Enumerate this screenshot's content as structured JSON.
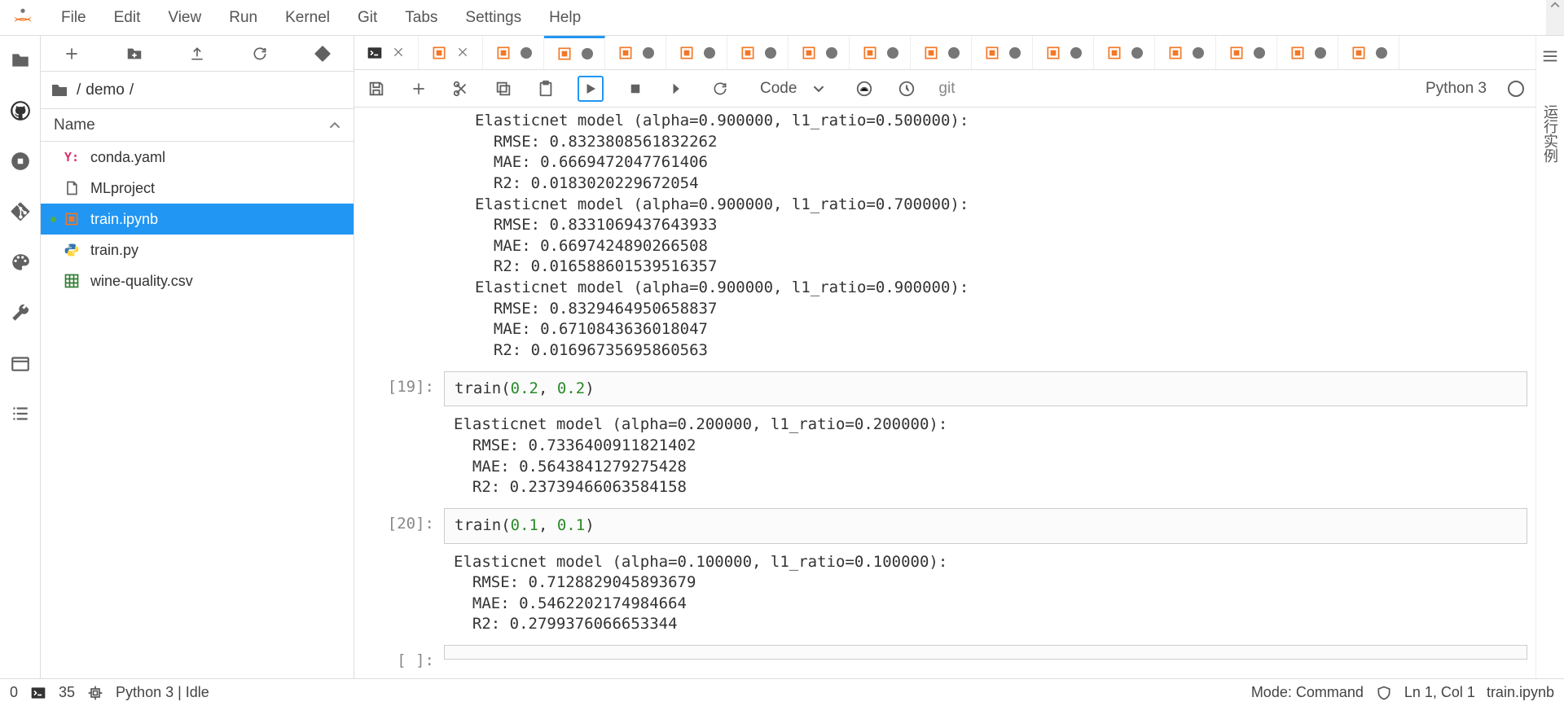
{
  "menubar": [
    "File",
    "Edit",
    "View",
    "Run",
    "Kernel",
    "Git",
    "Tabs",
    "Settings",
    "Help"
  ],
  "filebrowser": {
    "breadcrumbs": [
      "/",
      "demo",
      "/"
    ],
    "name_header": "Name",
    "files": [
      {
        "name": "conda.yaml",
        "icon": "yaml",
        "selected": false
      },
      {
        "name": "MLproject",
        "icon": "file",
        "selected": false
      },
      {
        "name": "train.ipynb",
        "icon": "nb",
        "selected": true,
        "running": true
      },
      {
        "name": "train.py",
        "icon": "py",
        "selected": false
      },
      {
        "name": "wine-quality.csv",
        "icon": "csv",
        "selected": false
      }
    ]
  },
  "tabs": [
    {
      "icon": "terminal",
      "dotType": "close"
    },
    {
      "icon": "nb",
      "dotType": "close"
    },
    {
      "icon": "nb",
      "dotType": "dot"
    },
    {
      "icon": "nb",
      "dotType": "dot",
      "active": true
    },
    {
      "icon": "nb",
      "dotType": "dot"
    },
    {
      "icon": "nb",
      "dotType": "dot"
    },
    {
      "icon": "nb",
      "dotType": "dot"
    },
    {
      "icon": "nb",
      "dotType": "dot"
    },
    {
      "icon": "nb",
      "dotType": "dot"
    },
    {
      "icon": "nb",
      "dotType": "dot"
    },
    {
      "icon": "nb",
      "dotType": "dot"
    },
    {
      "icon": "nb",
      "dotType": "dot"
    },
    {
      "icon": "nb",
      "dotType": "dot"
    },
    {
      "icon": "nb",
      "dotType": "dot"
    },
    {
      "icon": "nb",
      "dotType": "dot"
    },
    {
      "icon": "nb",
      "dotType": "dot"
    },
    {
      "icon": "nb",
      "dotType": "dot"
    }
  ],
  "nb_toolbar": {
    "cell_type": "Code",
    "git_label": "git",
    "kernel_name": "Python 3"
  },
  "initial_output": "Elasticnet model (alpha=0.900000, l1_ratio=0.500000):\n  RMSE: 0.8323808561832262\n  MAE: 0.6669472047761406\n  R2: 0.0183020229672054\nElasticnet model (alpha=0.900000, l1_ratio=0.700000):\n  RMSE: 0.8331069437643933\n  MAE: 0.6697424890266508\n  R2: 0.016588601539516357\nElasticnet model (alpha=0.900000, l1_ratio=0.900000):\n  RMSE: 0.8329464950658837\n  MAE: 0.6710843636018047\n  R2: 0.01696735695860563",
  "cells": [
    {
      "prompt": "[19]:",
      "code_html": "train(<span class='num'>0.2</span>, <span class='num'>0.2</span>)",
      "output": "Elasticnet model (alpha=0.200000, l1_ratio=0.200000):\n  RMSE: 0.7336400911821402\n  MAE: 0.5643841279275428\n  R2: 0.23739466063584158"
    },
    {
      "prompt": "[20]:",
      "code_html": "train(<span class='num'>0.1</span>, <span class='num'>0.1</span>)",
      "output": "Elasticnet model (alpha=0.100000, l1_ratio=0.100000):\n  RMSE: 0.7128829045893679\n  MAE: 0.5462202174984664\n  R2: 0.2799376066653344"
    },
    {
      "prompt": "[ ]:",
      "code_html": "",
      "output": null
    }
  ],
  "right_label": "运行实例",
  "statusbar": {
    "sessions": "0",
    "terminals": "35",
    "kernel": "Python 3 | Idle",
    "mode": "Mode: Command",
    "line": "Ln 1, Col 1",
    "file": "train.ipynb"
  }
}
